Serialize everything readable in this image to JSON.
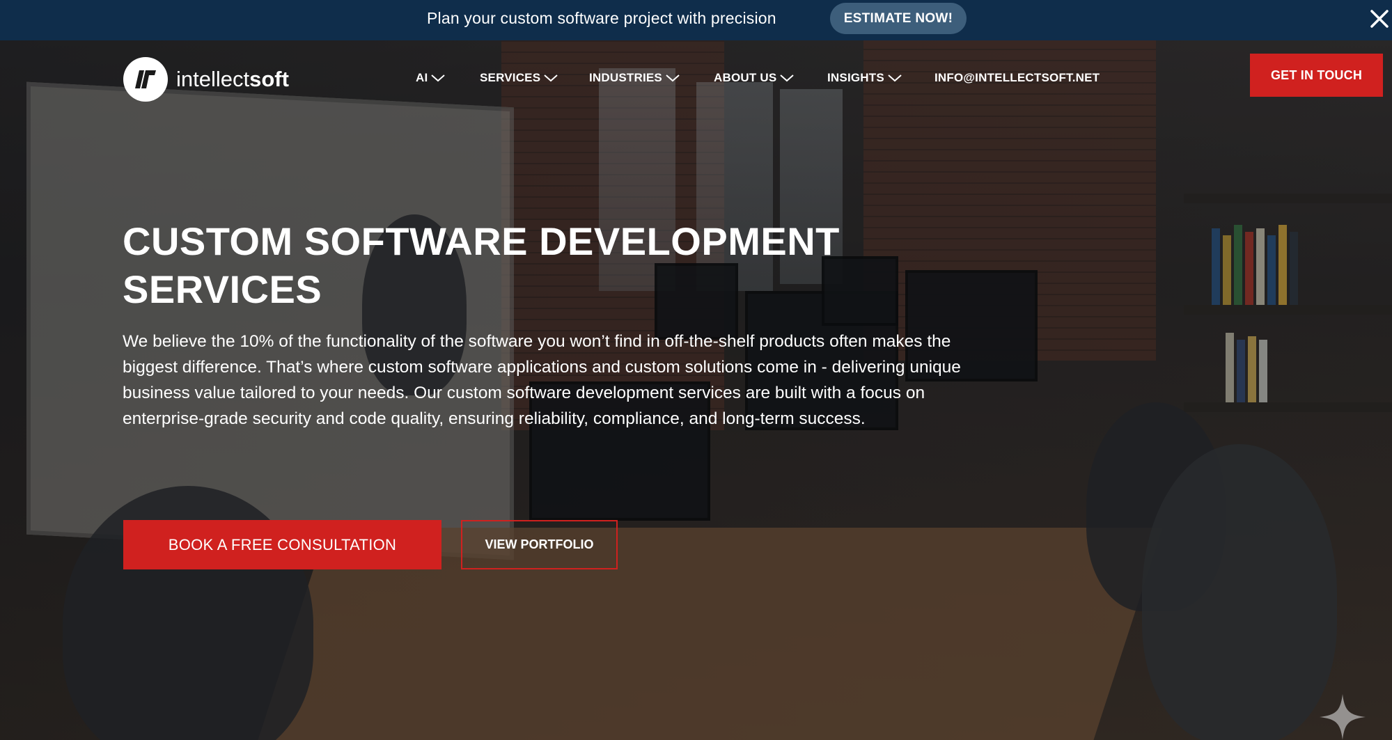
{
  "announcement": {
    "text": "Plan your custom software project with precision",
    "cta_label": "ESTIMATE NOW!",
    "close_icon": "close-icon"
  },
  "header": {
    "logo": {
      "prefix": "intellect",
      "suffix": "soft",
      "mark_icon": "intellectsoft-logo-icon"
    },
    "nav": [
      {
        "label": "AI",
        "has_dropdown": true
      },
      {
        "label": "SERVICES",
        "has_dropdown": true
      },
      {
        "label": "INDUSTRIES",
        "has_dropdown": true
      },
      {
        "label": "ABOUT US",
        "has_dropdown": true
      },
      {
        "label": "INSIGHTS",
        "has_dropdown": true
      },
      {
        "label": "INFO@INTELLECTSOFT.NET",
        "has_dropdown": false
      }
    ],
    "cta_label": "GET IN TOUCH"
  },
  "hero": {
    "title": "CUSTOM SOFTWARE DEVELOPMENT SERVICES",
    "description": "We believe the 10% of the functionality of the software you won’t find in off-the-shelf products often makes the biggest difference. That’s where custom software applications and custom solutions come in - delivering unique business value tailored to your needs. Our custom software development services are built with a focus on enterprise-grade security and code quality, ensuring reliability, compliance, and long-term success.",
    "primary_cta": "BOOK A FREE CONSULTATION",
    "secondary_cta": "VIEW PORTFOLIO"
  },
  "colors": {
    "announcement_bg": "#0f2d4b",
    "estimate_btn_bg": "#3d5e7b",
    "accent_red": "#d0211f",
    "text": "#ffffff"
  }
}
